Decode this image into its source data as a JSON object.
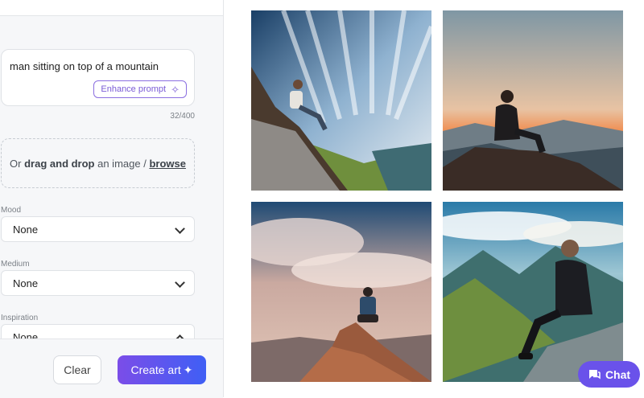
{
  "prompt": {
    "text": "man sitting on top of a mountain",
    "enhance_label": "Enhance prompt",
    "char_count": "32/400"
  },
  "upload": {
    "prefix": "Or ",
    "drag_label": "drag and drop",
    "middle": " an image / ",
    "browse_label": "browse"
  },
  "fields": {
    "mood": {
      "label": "Mood",
      "value": "None"
    },
    "medium": {
      "label": "Medium",
      "value": "None"
    },
    "inspiration": {
      "label": "Inspiration",
      "value": "None"
    }
  },
  "actions": {
    "clear_label": "Clear",
    "create_label": "Create art"
  },
  "chat": {
    "label": "Chat"
  },
  "icons": [
    "sparkle-icon",
    "chevron-down-icon",
    "chevron-up-icon",
    "chat-icon"
  ],
  "colors": {
    "accent": "#7b4de8",
    "accent_end": "#3f5ff5",
    "chat": "#6a52ea"
  }
}
